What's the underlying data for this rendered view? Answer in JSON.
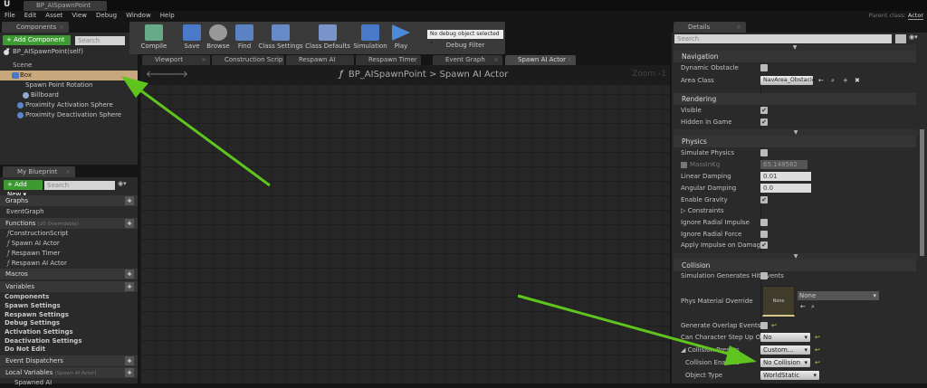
{
  "window": {
    "tab_title": "BP_AISpawnPoint",
    "parent_label": "Parent class:",
    "parent_value": "Actor"
  },
  "menu": [
    "File",
    "Edit",
    "Asset",
    "View",
    "Debug",
    "Window",
    "Help"
  ],
  "components": {
    "tab": "Components",
    "add_button": "+ Add Component ▾",
    "search_placeholder": "Search",
    "self": "BP_AISpawnPoint(self)",
    "tree": [
      "Scene",
      "Box",
      "Spawn Point Rotation",
      "Billboard",
      "Proximity Activation Sphere",
      "Proximity Deactivation Sphere"
    ]
  },
  "toolbar": {
    "compile": "Compile",
    "save": "Save",
    "browse": "Browse",
    "find": "Find",
    "class_settings": "Class Settings",
    "class_defaults": "Class Defaults",
    "simulation": "Simulation",
    "play": "Play",
    "debug_object": "No debug object selected",
    "debug_filter": "Debug Filter"
  },
  "graph_tabs": [
    "Viewport",
    "Construction Scrip",
    "Respawn AI Actor",
    "Respawn Timer",
    "Event Graph",
    "Spawn AI Actor"
  ],
  "graph": {
    "breadcrumb_bp": "BP_AISpawnPoint",
    "breadcrumb_sep": ">",
    "breadcrumb_fn": "Spawn AI Actor",
    "zoom": "Zoom -1"
  },
  "my_blueprint": {
    "tab": "My Blueprint",
    "add_button": "+ Add New ▾",
    "search_placeholder": "Search",
    "graphs_label": "Graphs",
    "graphs": [
      "EventGraph"
    ],
    "functions_label": "Functions",
    "functions_note": "(20 Overridable)",
    "functions": [
      "ConstructionScript",
      "Spawn AI Actor",
      "Respawn Timer",
      "Respawn AI Actor"
    ],
    "macros_label": "Macros",
    "variables_label": "Variables",
    "variables": [
      "Components",
      "Spawn Settings",
      "Respawn Settings",
      "Debug Settings",
      "Activation Settings",
      "Deactivation Settings",
      "Do Not Edit"
    ],
    "dispatchers_label": "Event Dispatchers",
    "local_label": "Local Variables",
    "local_note": "(Spawn AI Actor)",
    "local_first": "Spawned AI"
  },
  "details": {
    "tab": "Details",
    "search_placeholder": "Search",
    "navigation": {
      "label": "Navigation",
      "dynamic_obstacle": "Dynamic Obstacle",
      "area_class": "Area Class",
      "area_value": "NavArea_Obstacle"
    },
    "rendering": {
      "label": "Rendering",
      "visible": "Visible",
      "hidden": "Hidden in Game"
    },
    "physics": {
      "label": "Physics",
      "simulate": "Simulate Physics",
      "mass": "MassInKg",
      "mass_value": "65.148582",
      "linear": "Linear Damping",
      "linear_value": "0.01",
      "angular": "Angular Damping",
      "angular_value": "0.0",
      "gravity": "Enable Gravity",
      "constraints": "Constraints",
      "radial_impulse": "Ignore Radial Impulse",
      "radial_force": "Ignore Radial Force",
      "impulse_damage": "Apply Impulse on Damage"
    },
    "collision": {
      "label": "Collision",
      "hit_events": "Simulation Generates Hit Events",
      "phys_mat": "Phys Material Override",
      "phys_thumb": "None",
      "phys_value": "None",
      "overlap": "Generate Overlap Events",
      "step_up": "Can Character Step Up On",
      "step_up_value": "No",
      "presets": "Collision Presets",
      "presets_value": "Custom...",
      "enabled": "Collision Enabled",
      "enabled_value": "No Collision",
      "object_type": "Object Type",
      "object_type_value": "WorldStatic"
    }
  },
  "colors": {
    "accent_green": "#4fb52a",
    "selected_row": "#c9a77c",
    "annotation_arrow": "#5fc41e"
  }
}
